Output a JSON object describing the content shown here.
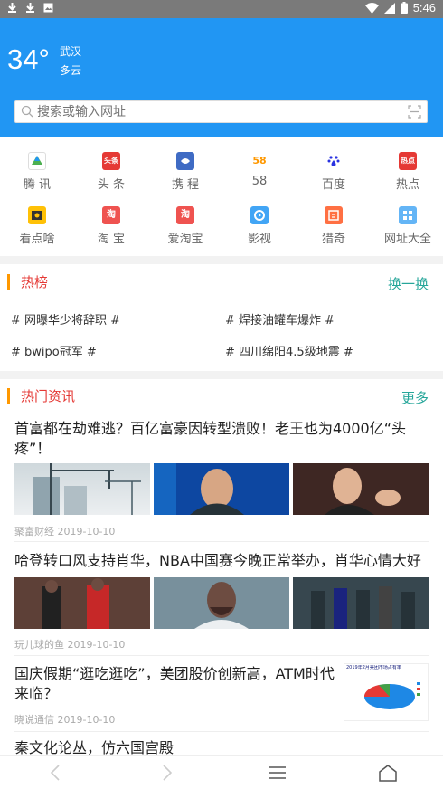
{
  "status_bar": {
    "time": "5:46",
    "icons": [
      "download-icon",
      "download-icon",
      "image-icon",
      "wifi-icon",
      "signal-icon",
      "battery-icon"
    ]
  },
  "weather": {
    "temperature": "34°",
    "city": "武汉",
    "condition": "多云"
  },
  "search": {
    "placeholder": "搜索或输入网址"
  },
  "shortcuts": [
    {
      "label": "腾 讯",
      "icon": "tencent-icon",
      "color": "#4caf50"
    },
    {
      "label": "头 条",
      "icon": "toutiao-icon",
      "color": "#e53935",
      "glyph": "头条"
    },
    {
      "label": "携 程",
      "icon": "ctrip-icon",
      "color": "#3f6bc4"
    },
    {
      "label": "58",
      "icon": "58-icon",
      "color": "#ffffff",
      "glyph": "58"
    },
    {
      "label": "百度",
      "icon": "baidu-icon",
      "color": "#ffffff"
    },
    {
      "label": "热点",
      "icon": "hotspot-icon",
      "color": "#e53935",
      "glyph": "热点"
    },
    {
      "label": "看点啥",
      "icon": "kandian-icon",
      "color": "#ffc107"
    },
    {
      "label": "淘 宝",
      "icon": "taobao-icon",
      "color": "#ef5350",
      "glyph": "淘"
    },
    {
      "label": "爱淘宝",
      "icon": "aitaobao-icon",
      "color": "#ef5350",
      "glyph": "淘"
    },
    {
      "label": "影视",
      "icon": "video-icon",
      "color": "#42a5f5"
    },
    {
      "label": "猎奇",
      "icon": "lieqi-icon",
      "color": "#ff7043"
    },
    {
      "label": "网址大全",
      "icon": "sites-icon",
      "color": "#64b5f6"
    }
  ],
  "hot_list": {
    "title": "热榜",
    "refresh_label": "换一换",
    "items": [
      "# 网曝华少将辞职 #",
      "# 焊接油罐车爆炸 #",
      "# bwipo冠军 #",
      "# 四川绵阳4.5级地震 #"
    ]
  },
  "hot_news": {
    "title": "热门资讯",
    "more_label": "更多",
    "items": [
      {
        "title": "首富都在劫难逃？百亿富豪因转型溃败！老王也为4000亿“头疼”！",
        "source": "聚富财经 2019-10-10"
      },
      {
        "title": "哈登转口风支持肖华，NBA中国赛今晚正常举办，肖华心情大好",
        "source": "玩儿球的鱼 2019-10-10"
      },
      {
        "title": "国庆假期“逛吃逛吃”，美团股价创新高，ATM时代来临？",
        "source": "晓说通信 2019-10-10",
        "chart_caption": "2019年2月美团市场占有率"
      },
      {
        "title": "秦文化论丛，仿六国宫殿"
      }
    ]
  },
  "colors": {
    "header": "#2196f3",
    "accent_red": "#e53935",
    "accent_teal": "#26a69a",
    "bar_orange": "#ff9800"
  }
}
